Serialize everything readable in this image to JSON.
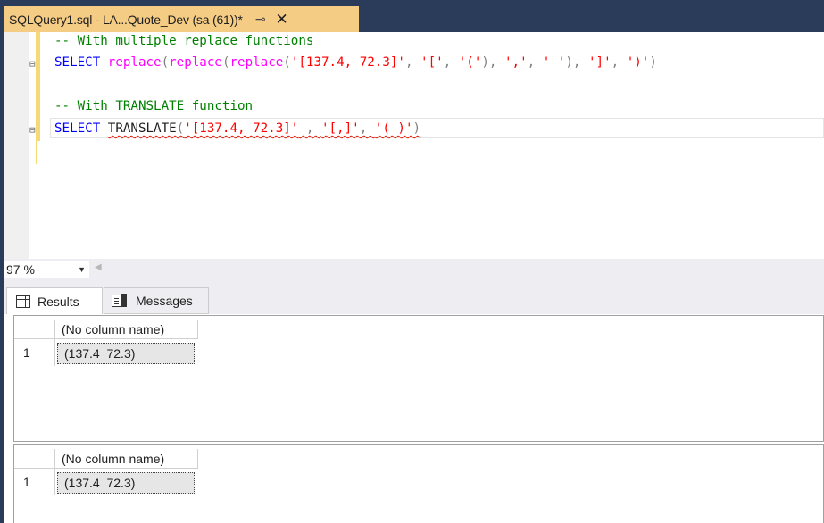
{
  "tab": {
    "title": "SQLQuery1.sql - LA...Quote_Dev (sa (61))*",
    "pin_icon": "pin-icon",
    "close_icon": "close-icon",
    "accent_color": "#f5cc84"
  },
  "editor": {
    "lines": [
      {
        "comment": "-- With multiple replace functions"
      },
      {
        "kw": "SELECT",
        "fn1": "replace",
        "p1": "(",
        "fn2": "replace",
        "p2": "(",
        "fn3": "replace",
        "p3": "(",
        "s1": "'[137.4, 72.3]'",
        "c1": ", ",
        "s2": "'['",
        "c2": ", ",
        "s3": "'('",
        "p4": "), ",
        "s4": "','",
        "c3": ", ",
        "s5": "' '",
        "p5": "), ",
        "s6": "']'",
        "c4": ", ",
        "s7": "')'",
        "p6": ")"
      },
      {
        "comment": "-- With TRANSLATE function"
      },
      {
        "kw": "SELECT",
        "fn": "TRANSLATE",
        "p1": "(",
        "s1": "'[137.4, 72.3]'",
        "c1": " , ",
        "s2": "'[,]'",
        "c2": ", ",
        "s3": "'( )'",
        "p2": ")"
      }
    ],
    "fold_markers": [
      "⊟",
      "⊟"
    ]
  },
  "zoom": {
    "value": "97 %",
    "dropdown_icon": "chevron-down-icon"
  },
  "result_tabs": [
    {
      "label": "Results",
      "icon": "grid-icon",
      "active": true
    },
    {
      "label": "Messages",
      "icon": "messages-icon",
      "active": false
    }
  ],
  "result_grids": [
    {
      "column_header": "(No column name)",
      "row_number": "1",
      "value": "(137.4  72.3)"
    },
    {
      "column_header": "(No column name)",
      "row_number": "1",
      "value": "(137.4  72.3)"
    }
  ]
}
